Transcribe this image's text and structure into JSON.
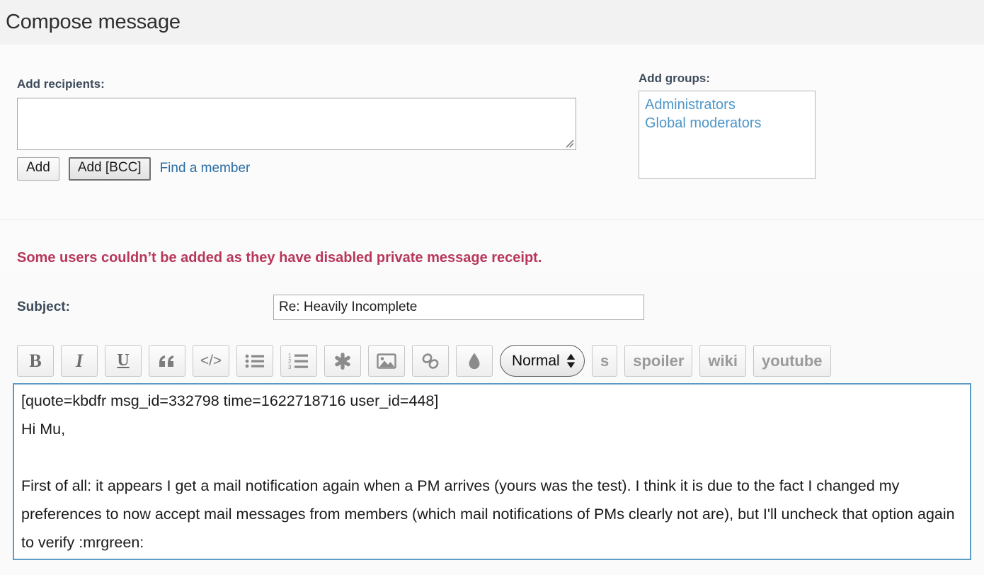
{
  "header": {
    "title": "Compose message"
  },
  "recipients": {
    "label": "Add recipients:",
    "value": "",
    "placeholder": "",
    "add_button": "Add",
    "add_bcc_button": "Add [BCC]",
    "find_member_link": "Find a member"
  },
  "groups": {
    "label": "Add groups:",
    "items": [
      {
        "label": "Administrators"
      },
      {
        "label": "Global moderators"
      }
    ]
  },
  "error": {
    "message": "Some users couldn’t be added as they have disabled private message receipt.",
    "color": "#b8365a"
  },
  "subject": {
    "label": "Subject:",
    "value": "Re: Heavily Incomplete",
    "placeholder": ""
  },
  "toolbar": {
    "buttons": [
      {
        "name": "bold",
        "glyph": "B"
      },
      {
        "name": "italic",
        "glyph": "I"
      },
      {
        "name": "underline",
        "glyph": "U"
      },
      {
        "name": "quote",
        "glyph": "“"
      },
      {
        "name": "code",
        "glyph": "</>"
      },
      {
        "name": "unordered-list",
        "glyph": ""
      },
      {
        "name": "ordered-list",
        "glyph": ""
      },
      {
        "name": "asterisk",
        "glyph": "✻"
      },
      {
        "name": "image",
        "glyph": ""
      },
      {
        "name": "link",
        "glyph": ""
      },
      {
        "name": "droplet",
        "glyph": ""
      }
    ],
    "format_select": {
      "value": "Normal",
      "options": [
        "Normal"
      ]
    },
    "strike_label": "s",
    "spoiler_label": "spoiler",
    "wiki_label": "wiki",
    "youtube_label": "youtube"
  },
  "editor": {
    "content": "[quote=kbdfr msg_id=332798 time=1622718716 user_id=448]\nHi Mu,\n\nFirst of all: it appears I get a mail notification again when a PM arrives (yours was the test). I think it is due to the fact I changed my preferences to now accept mail messages from members (which mail notifications of PMs clearly not are), but I'll uncheck that option again to verify :mrgreen:"
  },
  "colors": {
    "accent": "#5b9cc4",
    "link": "#2b6ca3",
    "label": "#3e4b5b",
    "group_link": "#4e96c8"
  }
}
